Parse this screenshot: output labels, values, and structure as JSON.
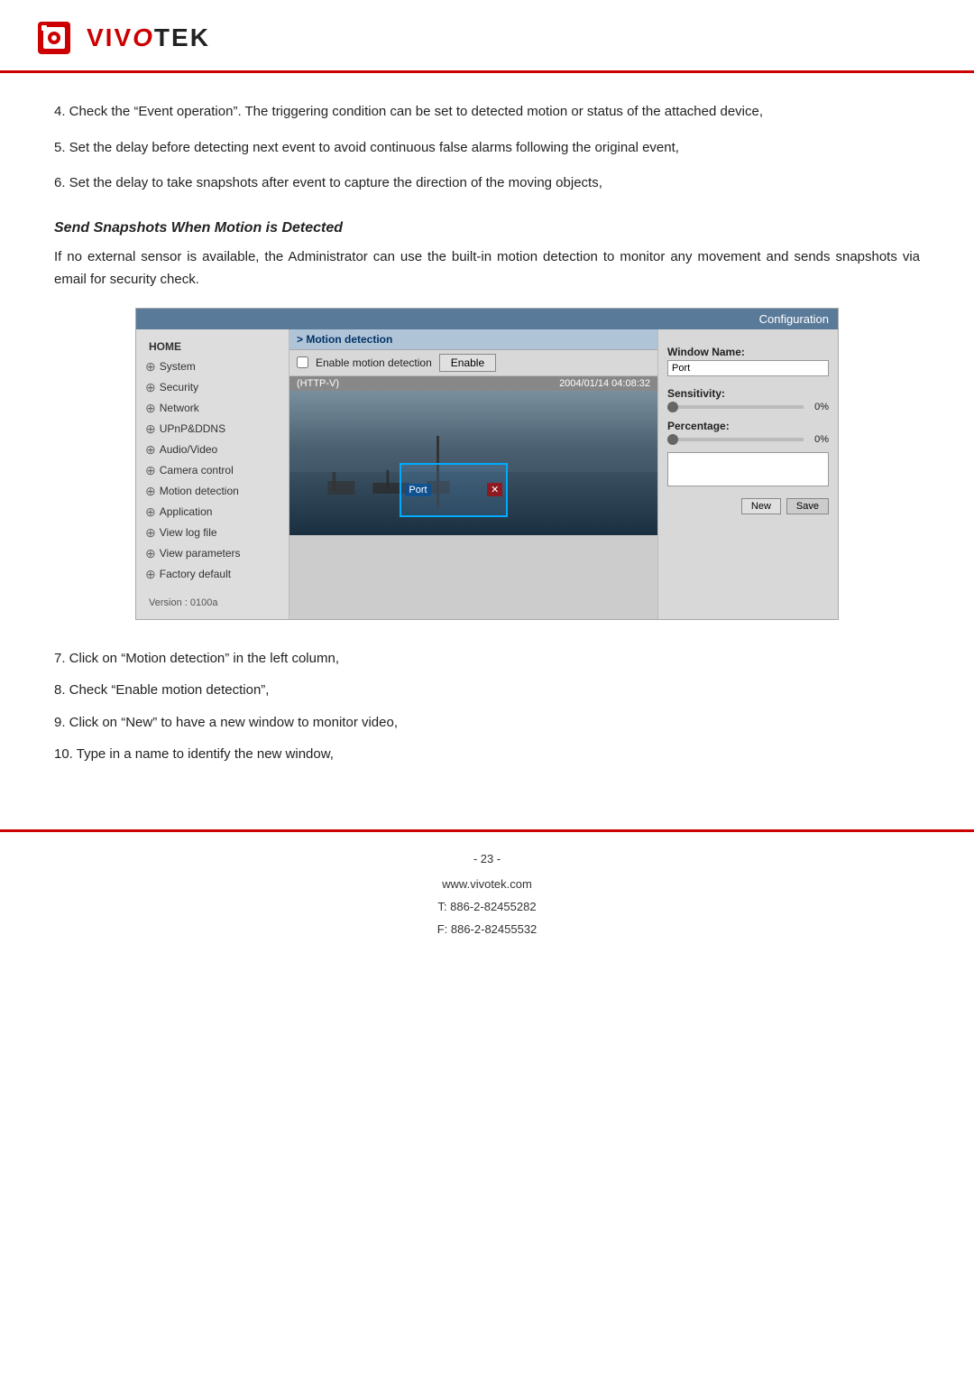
{
  "header": {
    "logo_text": "VIVOTEK",
    "alt": "VIVOTEK Logo"
  },
  "content": {
    "paragraphs": [
      "4. Check the “Event operation”. The triggering condition can be set to detected motion or status of the attached device,",
      "5. Set the delay before detecting next event to avoid continuous false alarms following the original event,",
      "6. Set the delay to take snapshots after event to capture the direction of the moving objects,"
    ],
    "section_title": "Send Snapshots When Motion is Detected",
    "section_desc": "If no external sensor is available, the Administrator can use the built-in motion detection to monitor any movement and sends snapshots via email for security check."
  },
  "ui": {
    "title_bar": "Configuration",
    "motion_bar": "> Motion detection",
    "enable_checkbox_label": "Enable motion detection",
    "enable_btn_label": "Enable",
    "cam_header_left": "(HTTP-V)",
    "cam_header_right": "2004/01/14 04:08:32",
    "cam_selection_label": "Port",
    "nav": {
      "home": "HOME",
      "items": [
        "System",
        "Security",
        "Network",
        "UPnP&DDNS",
        "Audio/Video",
        "Camera control",
        "Motion detection",
        "Application",
        "View log file",
        "View parameters",
        "Factory default"
      ],
      "version": "Version : 0100a"
    },
    "right_panel": {
      "window_name_label": "Window Name:",
      "window_name_value": "Port",
      "sensitivity_label": "Sensitivity:",
      "sensitivity_pct": "0%",
      "percentage_label": "Percentage:",
      "percentage_pct": "0%",
      "new_btn": "New",
      "save_btn": "Save"
    }
  },
  "steps": [
    "7. Click on “Motion detection” in the left column,",
    "8. Check “Enable motion detection”,",
    "9. Click on “New” to have a new window to monitor video,",
    "10. Type in a name to identify the new window,"
  ],
  "footer": {
    "page": "- 23 -",
    "website": "www.vivotek.com",
    "tel": "T: 886-2-82455282",
    "fax": "F: 886-2-82455532"
  }
}
